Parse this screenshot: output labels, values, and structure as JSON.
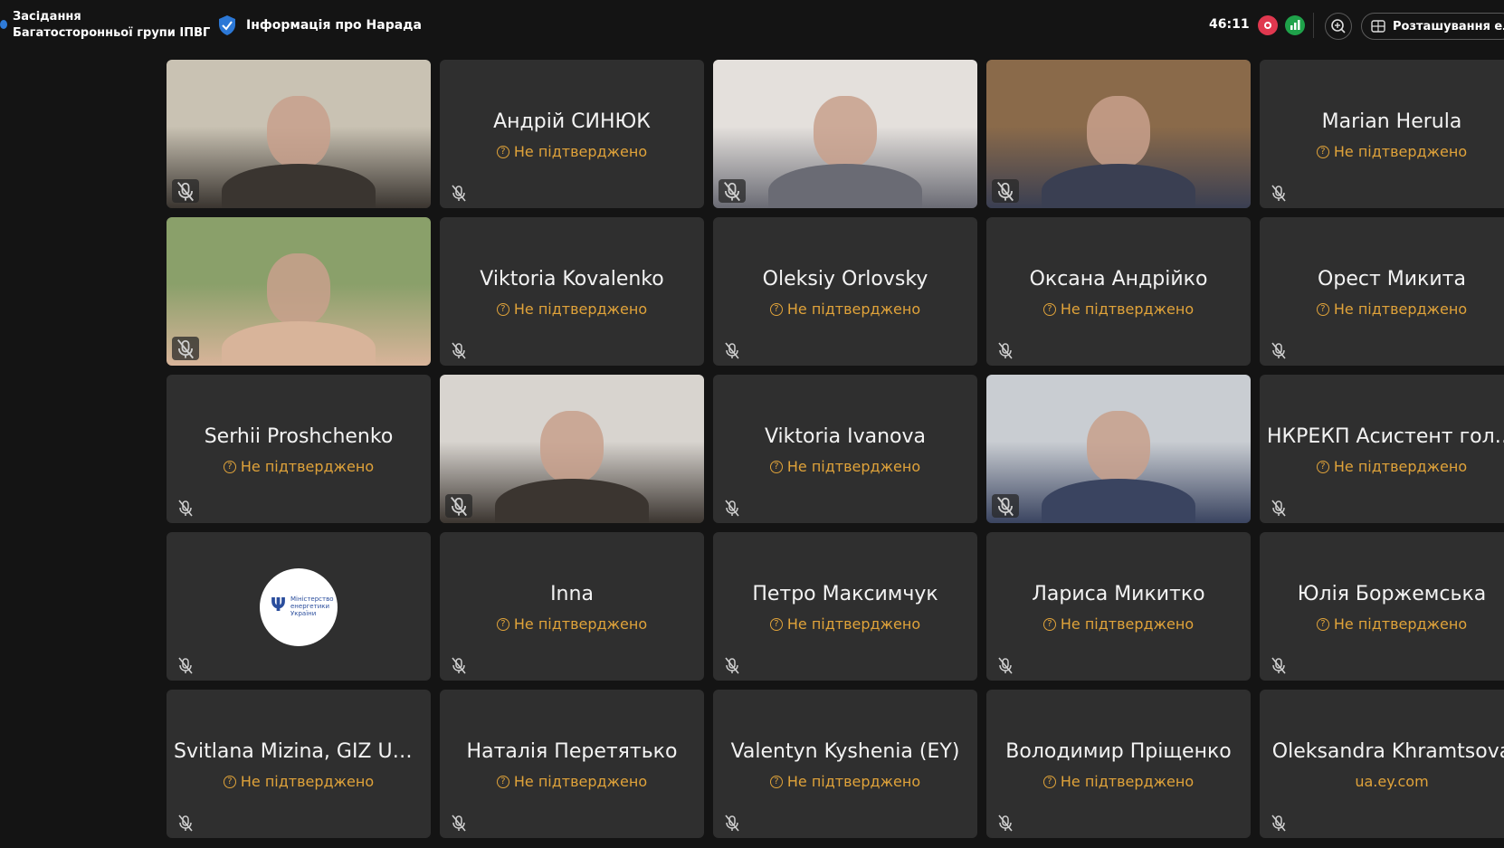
{
  "header": {
    "meeting_title_line1": "Засідання",
    "meeting_title_line2": "Багатосторонньої групи ІПВГ",
    "info_label": "Інформація про Нарада",
    "timer": "46:11",
    "layout_button_label": "Розташування ел",
    "icons": [
      "shield-icon",
      "record-icon",
      "signal-icon",
      "zoom-icon",
      "layout-icon"
    ],
    "colors": {
      "record": "#e0384f",
      "signal": "#1fa24a",
      "accent": "#e0a33a"
    }
  },
  "participants": [
    {
      "name": "",
      "status": "",
      "video": true
    },
    {
      "name": "Андрій СИНЮК",
      "status": "Не підтверджено",
      "video": false
    },
    {
      "name": "",
      "status": "",
      "video": true
    },
    {
      "name": "",
      "status": "",
      "video": true
    },
    {
      "name": "Marian Herula",
      "status": "Не підтверджено",
      "video": false
    },
    {
      "name": "",
      "status": "",
      "video": true
    },
    {
      "name": "Viktoria Kovalenko",
      "status": "Не підтверджено",
      "video": false
    },
    {
      "name": "Oleksiy Orlovsky",
      "status": "Не підтверджено",
      "video": false
    },
    {
      "name": "Оксана Андрійко",
      "status": "Не підтверджено",
      "video": false
    },
    {
      "name": "Орест Микита",
      "status": "Не підтверджено",
      "video": false
    },
    {
      "name": "Serhii Proshchenko",
      "status": "Не підтверджено",
      "video": false
    },
    {
      "name": "",
      "status": "",
      "video": true
    },
    {
      "name": "Viktoria Ivanova",
      "status": "Не підтверджено",
      "video": false
    },
    {
      "name": "",
      "status": "",
      "video": true
    },
    {
      "name": "НКРЕКП Асистент голови",
      "status": "Не підтверджено",
      "video": false
    },
    {
      "name": "",
      "status": "",
      "video": false,
      "logo_text": "Міністерство енергетики України"
    },
    {
      "name": "Inna",
      "status": "Не підтверджено",
      "video": false
    },
    {
      "name": "Петро Максимчук",
      "status": "Не підтверджено",
      "video": false
    },
    {
      "name": "Лариса Микитко",
      "status": "Не підтверджено",
      "video": false
    },
    {
      "name": "Юлія Боржемська",
      "status": "Не підтверджено",
      "video": false
    },
    {
      "name": "Svitlana Mizina, GIZ Ukra...",
      "status": "Не підтверджено",
      "video": false
    },
    {
      "name": "Наталія Перетятько",
      "status": "Не підтверджено",
      "video": false
    },
    {
      "name": "Valentyn Kyshenia (EY)",
      "status": "Не підтверджено",
      "video": false
    },
    {
      "name": "Володимир Пріщенко",
      "status": "Не підтверджено",
      "video": false
    },
    {
      "name": "Oleksandra Khramtsova",
      "status": "ua.ey.com",
      "video": false
    }
  ]
}
